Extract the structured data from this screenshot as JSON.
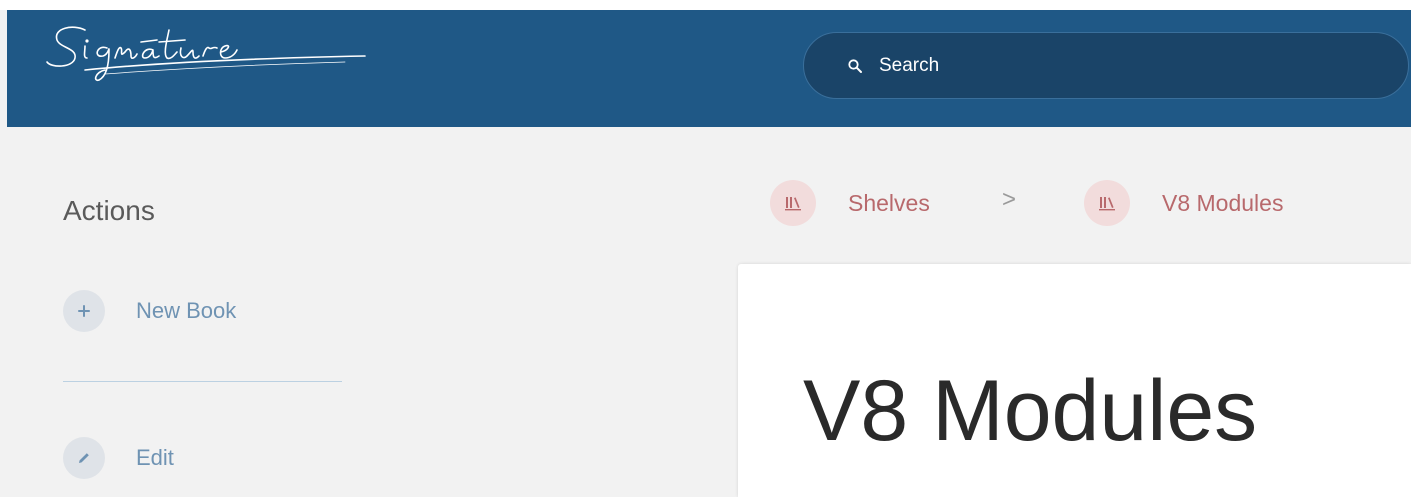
{
  "header": {
    "logo_text": "Signature",
    "search": {
      "placeholder": "Search",
      "icon": "search-icon"
    }
  },
  "sidebar": {
    "heading": "Actions",
    "actions": [
      {
        "label": "New Book",
        "icon": "plus-icon"
      },
      {
        "label": "Edit",
        "icon": "pencil-icon"
      }
    ]
  },
  "breadcrumb": {
    "items": [
      {
        "label": "Shelves",
        "icon": "bookshelf-icon"
      },
      {
        "label": "V8 Modules",
        "icon": "bookshelf-icon"
      }
    ],
    "separator": ">"
  },
  "main": {
    "title": "V8 Modules"
  },
  "colors": {
    "header_bg": "#1f5886",
    "search_bg": "#1a4468",
    "breadcrumb_accent": "#b8696c",
    "action_link": "#6f93b3",
    "page_bg": "#f2f2f2"
  }
}
